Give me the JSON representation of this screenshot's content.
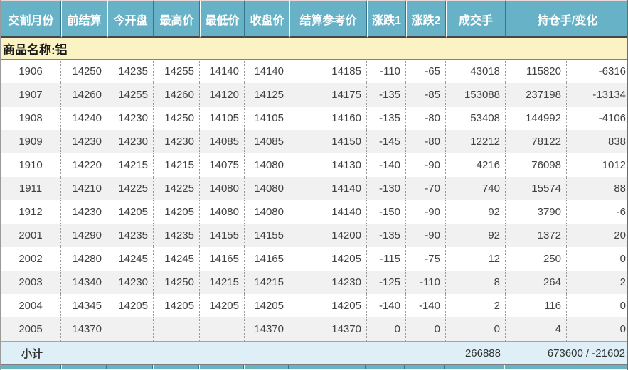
{
  "colors": {
    "header_bg": "#68B2C8",
    "header_text": "#FFFFFF",
    "product_row_bg": "#FBF3C4",
    "row_bg": "#FFFFFF",
    "alt_row_bg": "#F1F1F1",
    "subtotal_bg": "#DEEFF7",
    "column_divider": "#999999"
  },
  "table": {
    "columns": [
      "交割月份",
      "前结算",
      "今开盘",
      "最高价",
      "最低价",
      "收盘价",
      "结算参考价",
      "涨跌1",
      "涨跌2",
      "成交手",
      "持仓手/变化"
    ],
    "product_label": "商品名称:铝",
    "rows": [
      [
        "1906",
        "14250",
        "14235",
        "14255",
        "14140",
        "14140",
        "14185",
        "-110",
        "-65",
        "43018",
        "115820",
        "-6316"
      ],
      [
        "1907",
        "14260",
        "14255",
        "14260",
        "14120",
        "14125",
        "14175",
        "-135",
        "-85",
        "153088",
        "237198",
        "-13134"
      ],
      [
        "1908",
        "14240",
        "14230",
        "14250",
        "14105",
        "14105",
        "14160",
        "-135",
        "-80",
        "53408",
        "144992",
        "-4106"
      ],
      [
        "1909",
        "14230",
        "14230",
        "14230",
        "14085",
        "14085",
        "14150",
        "-145",
        "-80",
        "12212",
        "78122",
        "838"
      ],
      [
        "1910",
        "14220",
        "14215",
        "14215",
        "14075",
        "14080",
        "14130",
        "-140",
        "-90",
        "4216",
        "76098",
        "1012"
      ],
      [
        "1911",
        "14210",
        "14225",
        "14225",
        "14080",
        "14080",
        "14140",
        "-130",
        "-70",
        "740",
        "15574",
        "88"
      ],
      [
        "1912",
        "14230",
        "14205",
        "14205",
        "14080",
        "14080",
        "14140",
        "-150",
        "-90",
        "92",
        "3790",
        "-6"
      ],
      [
        "2001",
        "14290",
        "14235",
        "14235",
        "14155",
        "14155",
        "14200",
        "-135",
        "-90",
        "92",
        "1372",
        "20"
      ],
      [
        "2002",
        "14280",
        "14245",
        "14245",
        "14165",
        "14165",
        "14205",
        "-115",
        "-75",
        "12",
        "250",
        "0"
      ],
      [
        "2003",
        "14340",
        "14230",
        "14250",
        "14215",
        "14215",
        "14230",
        "-125",
        "-110",
        "8",
        "264",
        "2"
      ],
      [
        "2004",
        "14345",
        "14205",
        "14205",
        "14205",
        "14205",
        "14205",
        "-140",
        "-140",
        "2",
        "116",
        "0"
      ],
      [
        "2005",
        "14370",
        "",
        "",
        "",
        "14370",
        "14370",
        "0",
        "0",
        "0",
        "4",
        "0"
      ]
    ],
    "subtotal": {
      "label": "小计",
      "volume": "266888",
      "open_interest_change": "673600 / -21602"
    }
  }
}
